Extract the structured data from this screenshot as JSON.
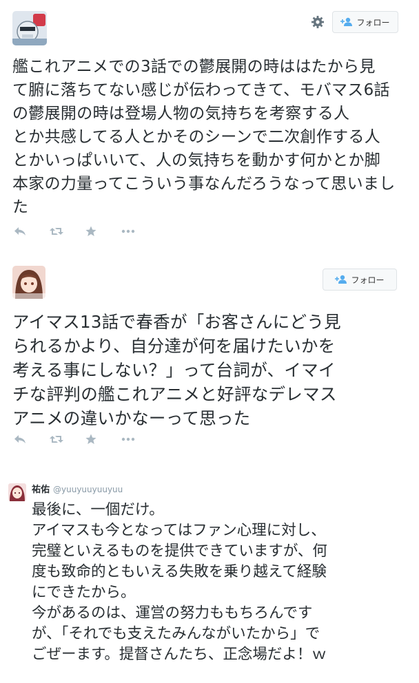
{
  "tweets": [
    {
      "follow_label": "フォロー",
      "lines": [
        "艦これアニメでの3話での鬱展開の時ははたから見",
        "て腑に落ちてない感じが伝わってきて、モバマス6話",
        "の鬱展開の時は登場人物の気持ちを考察する人",
        "とか共感してる人とかそのシーンで二次創作する人",
        "とかいっぱいいて、人の気持ちを動かす何かとか脚",
        "本家の力量ってこういう事なんだろうなって思いまし",
        "た"
      ]
    },
    {
      "follow_label": "フォロー",
      "lines": [
        "アイマス13話で春香が「お客さんにどう見",
        "られるかより、自分達が何を届けたいかを",
        "考える事にしない？」って台詞が、イマイ",
        "チな評判の艦これアニメと好評なデレマス",
        "アニメの違いかなーって思った"
      ]
    },
    {
      "name": "祐佑",
      "handle": "@yuuyuuyuuyuu",
      "lines": [
        "最後に、一個だけ。",
        "アイマスも今となってはファン心理に対し、",
        "完璧といえるものを提供できていますが、何",
        "度も致命的ともいえる失敗を乗り越えて経験",
        "にできたから。",
        "今があるのは、運営の努力ももちろんです",
        "が、「それでも支えたみんながいたから」で",
        "ごぜーます。提督さんたち、正念場だよ！ｗ"
      ]
    }
  ]
}
